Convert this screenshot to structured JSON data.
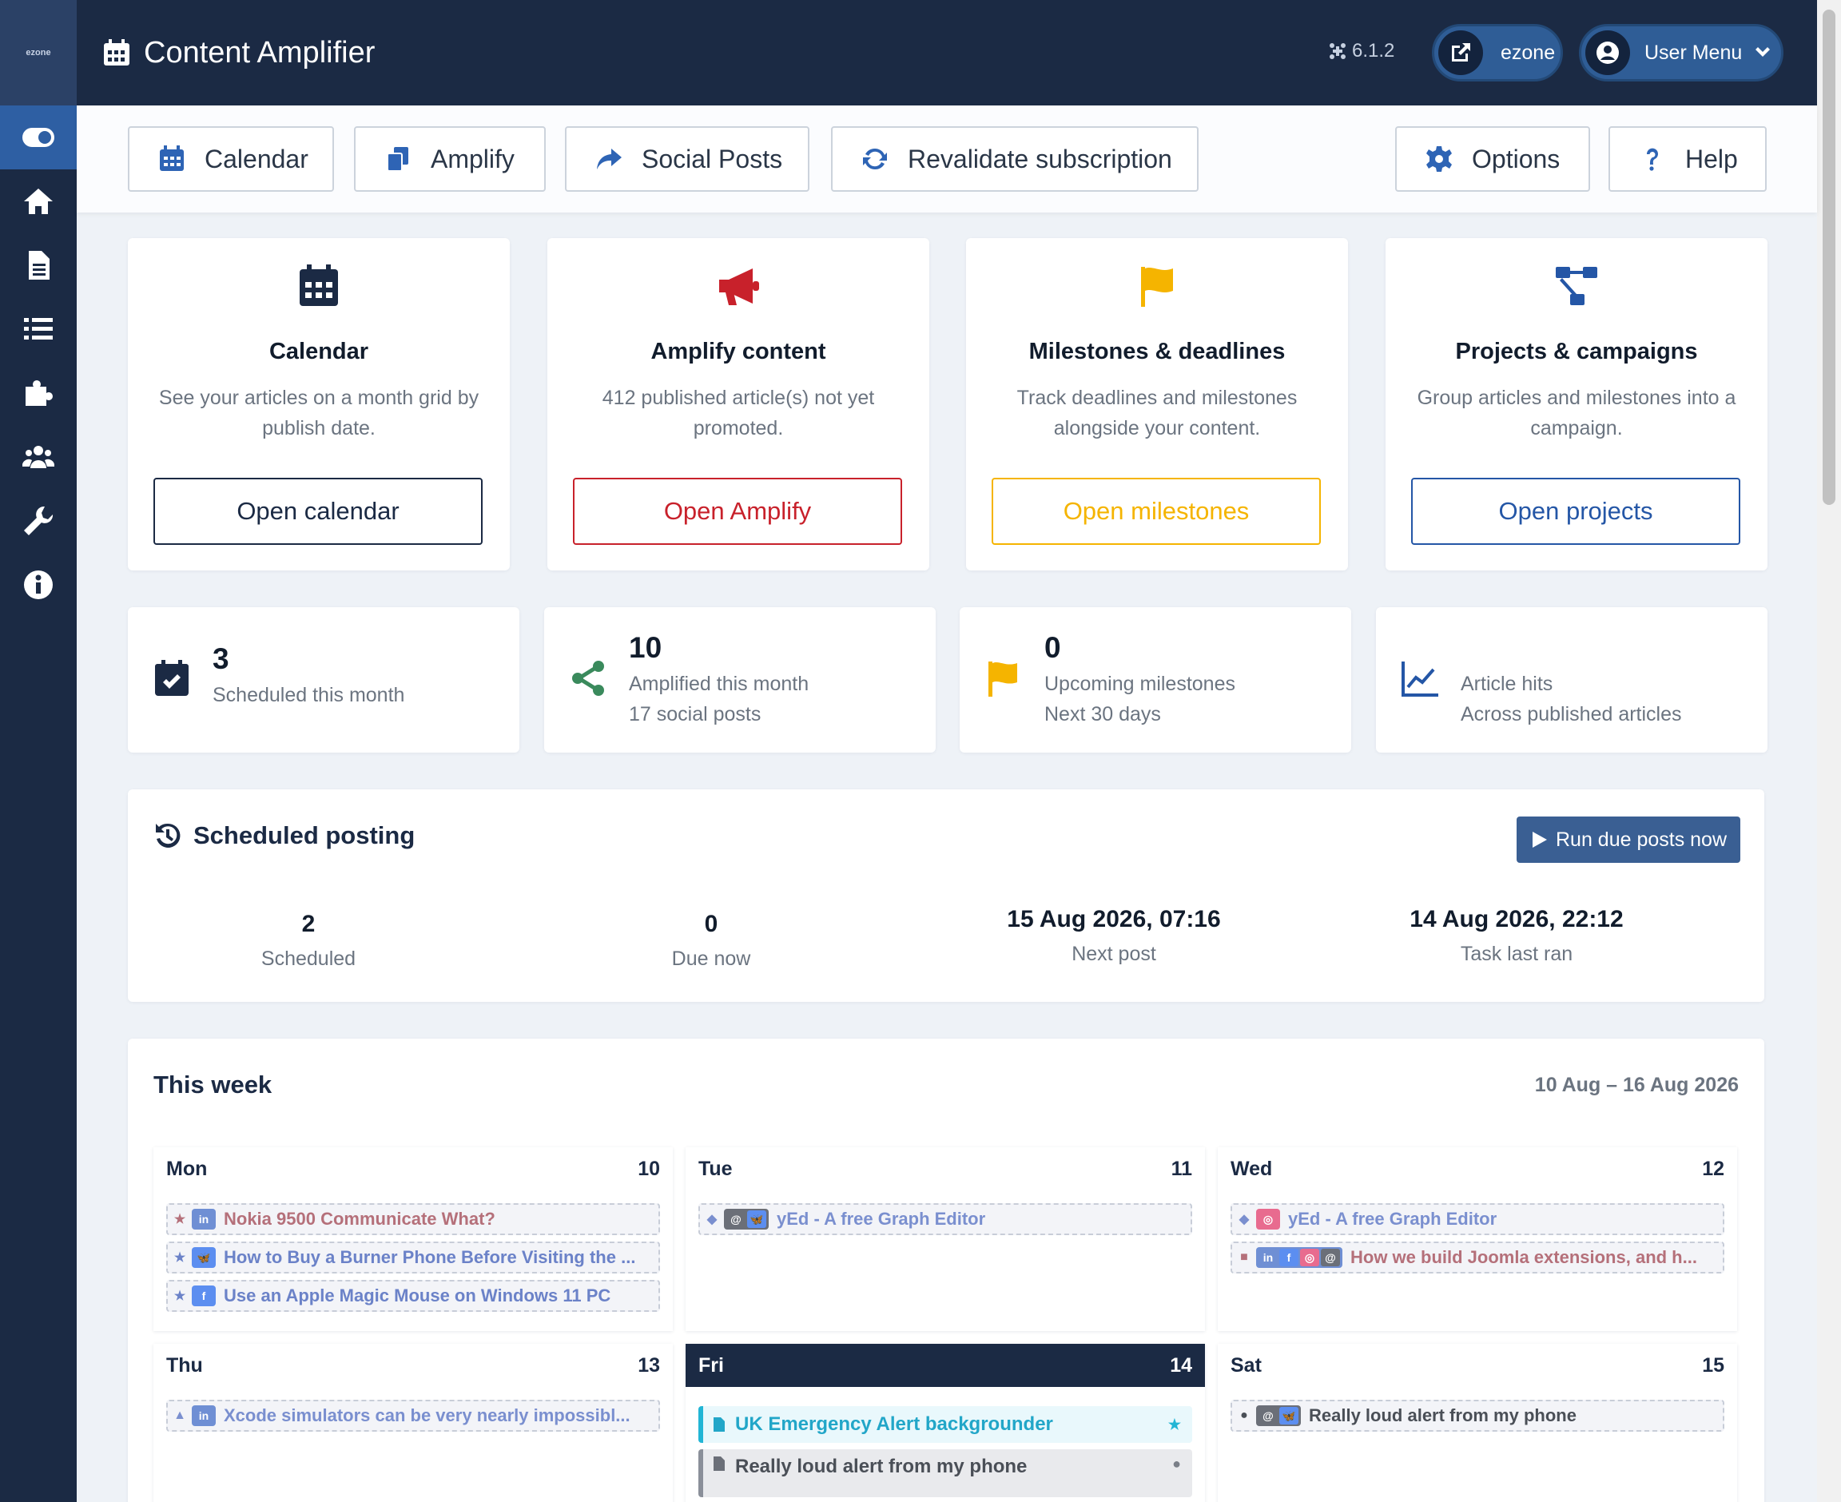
{
  "sidebar": {
    "brand": "ezone"
  },
  "header": {
    "title": "Content Amplifier",
    "version": "6.1.2",
    "site_label": "ezone",
    "user_menu": "User Menu"
  },
  "toolbar": {
    "calendar": "Calendar",
    "amplify": "Amplify",
    "social_posts": "Social Posts",
    "revalidate": "Revalidate subscription",
    "options": "Options",
    "help": "Help"
  },
  "features": [
    {
      "title": "Calendar",
      "desc": "See your articles on a month grid by publish date.",
      "button": "Open calendar",
      "color": "#1b2a44"
    },
    {
      "title": "Amplify content",
      "desc": "412 published article(s) not yet promoted.",
      "button": "Open Amplify",
      "color": "#c8212b"
    },
    {
      "title": "Milestones & deadlines",
      "desc": "Track deadlines and milestones alongside your content.",
      "button": "Open milestones",
      "color": "#f5b400"
    },
    {
      "title": "Projects & campaigns",
      "desc": "Group articles and milestones into a campaign.",
      "button": "Open projects",
      "color": "#2456a6"
    }
  ],
  "stats": [
    {
      "value": "3",
      "line1": "Scheduled this month",
      "line2": ""
    },
    {
      "value": "10",
      "line1": "Amplified this month",
      "line2": "17 social posts"
    },
    {
      "value": "0",
      "line1": "Upcoming milestones",
      "line2": "Next 30 days"
    },
    {
      "value": "",
      "line1": "Article hits",
      "line2": "Across published articles"
    }
  ],
  "posting": {
    "title": "Scheduled posting",
    "run_button": "Run due posts now",
    "items": [
      {
        "value": "2",
        "label": "Scheduled"
      },
      {
        "value": "0",
        "label": "Due now"
      },
      {
        "value": "15 Aug 2026, 07:16",
        "label": "Next post"
      },
      {
        "value": "14 Aug 2026, 22:12",
        "label": "Task last ran"
      }
    ]
  },
  "week": {
    "title": "This week",
    "range": "10 Aug – 16 Aug 2026",
    "days": [
      {
        "name": "Mon",
        "num": "10",
        "events": [
          {
            "marker": "★",
            "nets": [
              "in"
            ],
            "text": "Nokia 9500 Communicate What?",
            "color": "#b5707a"
          },
          {
            "marker": "★",
            "nets": [
              "bs"
            ],
            "text": "How to Buy a Burner Phone Before Visiting the ...",
            "color": "#6b82c8"
          },
          {
            "marker": "★",
            "nets": [
              "fb"
            ],
            "text": "Use an Apple Magic Mouse on Windows 11 PC",
            "color": "#6b82c8"
          }
        ]
      },
      {
        "name": "Tue",
        "num": "11",
        "events": [
          {
            "marker": "◆",
            "nets": [
              "th",
              "bs"
            ],
            "text": "yEd - A free Graph Editor",
            "color": "#7a8fcf"
          }
        ]
      },
      {
        "name": "Wed",
        "num": "12",
        "events": [
          {
            "marker": "◆",
            "nets": [
              "ig"
            ],
            "text": "yEd - A free Graph Editor",
            "color": "#7a8fcf"
          },
          {
            "marker": "■",
            "nets": [
              "in",
              "fb",
              "ig",
              "th"
            ],
            "text": "How we build Joomla extensions, and h...",
            "color": "#b5707a"
          }
        ]
      },
      {
        "name": "Thu",
        "num": "13",
        "events": [
          {
            "marker": "▲",
            "nets": [
              "in"
            ],
            "text": "Xcode simulators can be very nearly impossibl...",
            "color": "#7a8fcf"
          }
        ]
      },
      {
        "name": "Fri",
        "num": "14",
        "articles": [
          {
            "text": "UK Emergency Alert backgrounder",
            "star": "★"
          },
          {
            "text": "Really loud alert from my phone",
            "star": "●"
          }
        ]
      },
      {
        "name": "Sat",
        "num": "15",
        "events": [
          {
            "marker": "●",
            "nets": [
              "th",
              "bs"
            ],
            "text": "Really loud alert from my phone",
            "color": "#4a4f57"
          }
        ]
      }
    ]
  }
}
